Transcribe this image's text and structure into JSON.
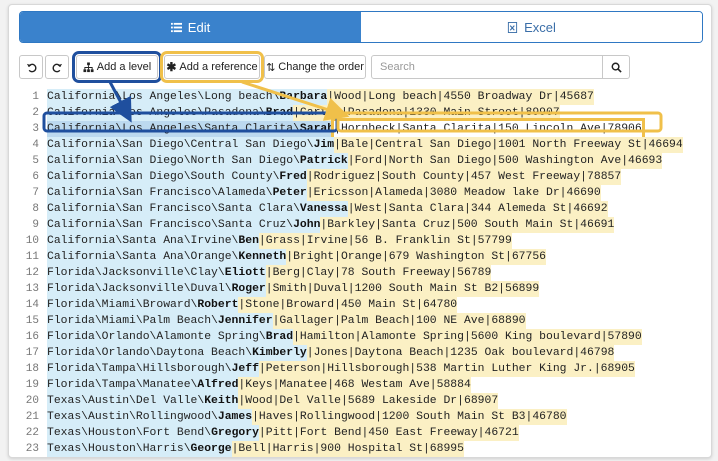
{
  "tabs": {
    "edit": "Edit",
    "excel": "Excel"
  },
  "toolbar": {
    "add_level": "Add a level",
    "add_reference": "Add a reference",
    "change_order": "Change the order",
    "search_placeholder": "Search"
  },
  "icons": {
    "edit": "list-icon",
    "excel": "excel-file-icon",
    "undo": "undo-icon",
    "redo": "redo-icon",
    "add_level": "hierarchy-icon",
    "add_reference": "asterisk-icon",
    "change_order": "sort-icon",
    "search": "search-icon"
  },
  "colors": {
    "accent": "#3a82cc",
    "level_highlight": "#1f4f9e",
    "reference_highlight": "#f0c04a",
    "path_bg": "#d6edf8",
    "rest_bg": "#fbf0c4"
  },
  "lines": [
    {
      "n": "1",
      "path": "California\\Los Angeles\\Long beach\\",
      "name": "Barbara",
      "rest": "|Wood|Long beach|4550 Broadway Dr|45687"
    },
    {
      "n": "2",
      "path": "California\\Los Angeles\\Pasadena\\",
      "name": "Brad",
      "rest": "|Carton|Pasadena|1330 Main Street|89907"
    },
    {
      "n": "3",
      "path": "California\\Los Angeles\\Santa Clarita\\",
      "name": "Sarah",
      "rest": "|Hornbeck|Santa Clarita|150 Lincoln Ave|78906"
    },
    {
      "n": "4",
      "path": "California\\San Diego\\Central San Diego\\",
      "name": "Jim",
      "rest": "|Bale|Central San Diego|1001 North Freeway St|46694"
    },
    {
      "n": "5",
      "path": "California\\San Diego\\North San Diego\\",
      "name": "Patrick",
      "rest": "|Ford|North San Diego|500 Washington Ave|46693"
    },
    {
      "n": "6",
      "path": "California\\San Diego\\South County\\",
      "name": "Fred",
      "rest": "|Rodriguez|South County|457 West Freeway|78857"
    },
    {
      "n": "7",
      "path": "California\\San Francisco\\Alameda\\",
      "name": "Peter",
      "rest": "|Ericsson|Alameda|3080 Meadow lake Dr|46690"
    },
    {
      "n": "8",
      "path": "California\\San Francisco\\Santa Clara\\",
      "name": "Vanessa",
      "rest": "|West|Santa Clara|344 Alemeda St|46692"
    },
    {
      "n": "9",
      "path": "California\\San Francisco\\Santa Cruz\\",
      "name": "John",
      "rest": "|Barkley|Santa Cruz|500 South Main St|46691"
    },
    {
      "n": "10",
      "path": "California\\Santa Ana\\Irvine\\",
      "name": "Ben",
      "rest": "|Grass|Irvine|56 B. Franklin St|57799"
    },
    {
      "n": "11",
      "path": "California\\Santa Ana\\Orange\\",
      "name": "Kenneth",
      "rest": "|Bright|Orange|679 Washington St|67756"
    },
    {
      "n": "12",
      "path": "Florida\\Jacksonville\\Clay\\",
      "name": "Eliott",
      "rest": "|Berg|Clay|78 South Freeway|56789"
    },
    {
      "n": "13",
      "path": "Florida\\Jacksonville\\Duval\\",
      "name": "Roger",
      "rest": "|Smith|Duval|1200 South Main St B2|56899"
    },
    {
      "n": "14",
      "path": "Florida\\Miami\\Broward\\",
      "name": "Robert",
      "rest": "|Stone|Broward|450 Main St|64780"
    },
    {
      "n": "15",
      "path": "Florida\\Miami\\Palm Beach\\",
      "name": "Jennifer",
      "rest": "|Gallager|Palm Beach|100 NE Ave|68890"
    },
    {
      "n": "16",
      "path": "Florida\\Orlando\\Alamonte Spring\\",
      "name": "Brad",
      "rest": "|Hamilton|Alamonte Spring|5600 King boulevard|57890"
    },
    {
      "n": "17",
      "path": "Florida\\Orlando\\Daytona Beach\\",
      "name": "Kimberly",
      "rest": "|Jones|Daytona Beach|1235 Oak boulevard|46798"
    },
    {
      "n": "18",
      "path": "Florida\\Tampa\\Hillsborough\\",
      "name": "Jeff",
      "rest": "|Peterson|Hillsborough|538 Martin Luther King Jr.|68905"
    },
    {
      "n": "19",
      "path": "Florida\\Tampa\\Manatee\\",
      "name": "Alfred",
      "rest": "|Keys|Manatee|468 Westam Ave|58884"
    },
    {
      "n": "20",
      "path": "Texas\\Austin\\Del Valle\\",
      "name": "Keith",
      "rest": "|Wood|Del Valle|5689 Lakeside Dr|68907"
    },
    {
      "n": "21",
      "path": "Texas\\Austin\\Rollingwood\\",
      "name": "James",
      "rest": "|Haves|Rollingwood|1200 South Main St B3|46780"
    },
    {
      "n": "22",
      "path": "Texas\\Houston\\Fort Bend\\",
      "name": "Gregory",
      "rest": "|Pitt|Fort Bend|450 East Freeway|46721"
    },
    {
      "n": "23",
      "path": "Texas\\Houston\\Harris\\",
      "name": "George",
      "rest": "|Bell|Harris|900 Hospital St|68995"
    }
  ]
}
